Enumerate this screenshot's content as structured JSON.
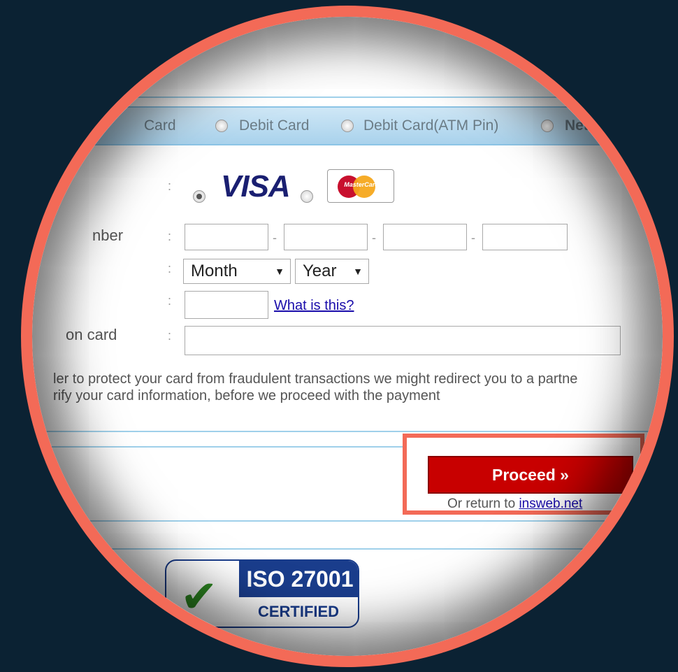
{
  "payment_tabs": [
    {
      "label": "Card",
      "selected": false
    },
    {
      "label": "Debit Card",
      "selected": false
    },
    {
      "label": "Debit Card(ATM Pin)",
      "selected": false
    },
    {
      "label": "Net B",
      "selected": false
    }
  ],
  "card_form": {
    "card_type_visa": "VISA",
    "card_type_mastercard": "MasterCard",
    "card_number_label": "nber",
    "name_on_card_label": "on card",
    "colon": ":",
    "dash": "-",
    "expiry_month": "Month",
    "expiry_year": "Year",
    "cvv_help_link": "What is this?"
  },
  "notice": {
    "line1": "ler to protect your card from fraudulent transactions we might redirect you to a partne",
    "line2": "rify your card information, before we proceed with the payment"
  },
  "actions": {
    "proceed_label": "Proceed »",
    "return_prefix": "Or return to",
    "return_link": "insweb.net"
  },
  "badge": {
    "title": "ISO 27001",
    "subtitle": "CERTIFIED"
  },
  "colors": {
    "accent_ring": "#f36a57",
    "proceed_button": "#c80000",
    "background": "#0b2233",
    "badge_blue": "#1a3d8c"
  }
}
